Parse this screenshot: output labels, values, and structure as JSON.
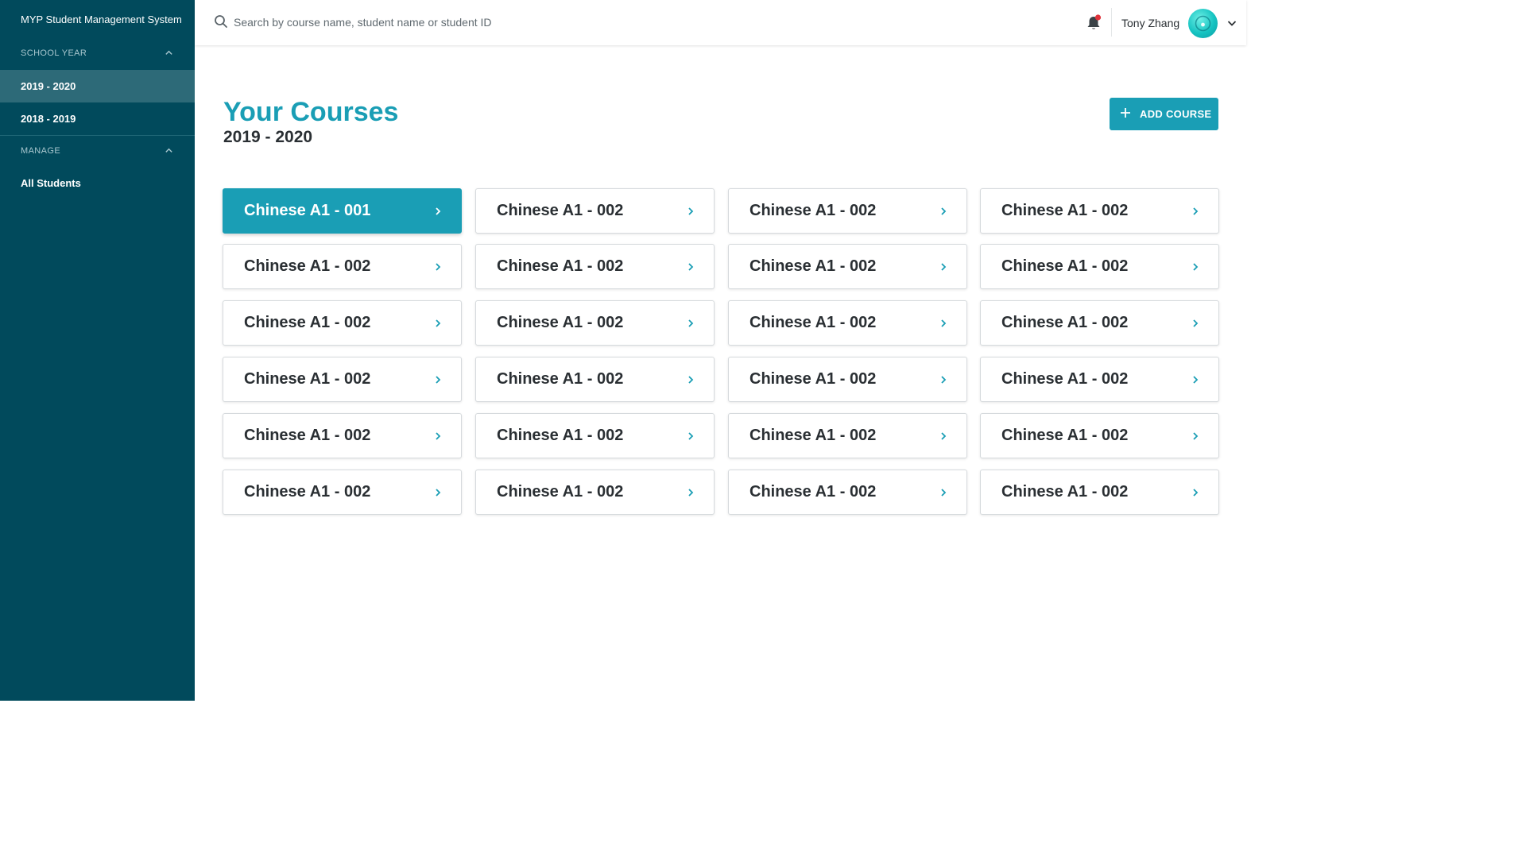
{
  "sidebar": {
    "app_title": "MYP Student Management System",
    "school_year_header": "SCHOOL YEAR",
    "years": [
      {
        "label": "2019 - 2020",
        "active": true
      },
      {
        "label": "2018 - 2019",
        "active": false
      }
    ],
    "manage_header": "MANAGE",
    "manage_items": [
      {
        "label": "All Students"
      }
    ]
  },
  "header": {
    "search_placeholder": "Search by course name, student name or student ID",
    "user_name": "Tony Zhang",
    "notification_icon": "bell-icon",
    "notification_dot_color": "#e0323a"
  },
  "main": {
    "title": "Your Courses",
    "subtitle": "2019 - 2020",
    "add_button_label": "ADD COURSE",
    "courses": [
      "Chinese A1 - 001",
      "Chinese A1 - 002",
      "Chinese A1 - 002",
      "Chinese A1 - 002",
      "Chinese A1 - 002",
      "Chinese A1 - 002",
      "Chinese A1 - 002",
      "Chinese A1 - 002",
      "Chinese A1 - 002",
      "Chinese A1 - 002",
      "Chinese A1 - 002",
      "Chinese A1 - 002",
      "Chinese A1 - 002",
      "Chinese A1 - 002",
      "Chinese A1 - 002",
      "Chinese A1 - 002",
      "Chinese A1 - 002",
      "Chinese A1 - 002",
      "Chinese A1 - 002",
      "Chinese A1 - 002",
      "Chinese A1 - 002",
      "Chinese A1 - 002",
      "Chinese A1 - 002",
      "Chinese A1 - 002"
    ],
    "selected_course_index": 0
  },
  "colors": {
    "sidebar_bg": "#014a5c",
    "sidebar_active": "#2d6a78",
    "accent": "#1a9eb5"
  }
}
